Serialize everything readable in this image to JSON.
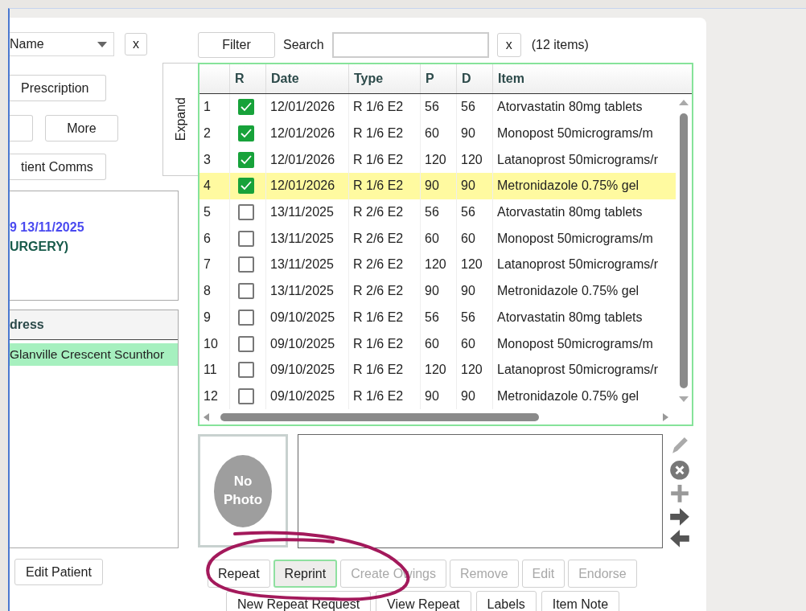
{
  "left_panel": {
    "sort_dropdown": {
      "value": "Name"
    },
    "clear_button": "x",
    "buttons": [
      {
        "kind": "wide",
        "label": "Prescription"
      },
      {
        "kind": "stub"
      },
      {
        "kind": "normal",
        "label": "More"
      },
      {
        "kind": "wide",
        "label": "tient Comms"
      }
    ],
    "info": [
      {
        "kind": "date",
        "text": "9 13/11/2025"
      },
      {
        "kind": "practice",
        "text": "URGERY)"
      }
    ],
    "address_table": {
      "column": "dress",
      "rows": [
        {
          "text": "Glanville Crescent Scunthor",
          "selected": true
        }
      ]
    },
    "edit_button": {
      "label": "Edit Patient"
    }
  },
  "expand_tab": {
    "label": "Expand"
  },
  "toolbar": {
    "filter_button": {
      "label": "Filter"
    },
    "search_label": "Search",
    "clear_button": "x",
    "count": "(12 items)"
  },
  "table": {
    "columns": [
      "R",
      "Date",
      "Type",
      "P",
      "D",
      "Item"
    ],
    "rows": [
      {
        "num": "1",
        "checked": true,
        "date": "12/01/2026",
        "type": "R 1/6 E2",
        "p": "56",
        "d": "56",
        "item": "Atorvastatin 80mg tablets",
        "selected": false
      },
      {
        "num": "2",
        "checked": true,
        "date": "12/01/2026",
        "type": "R 1/6 E2",
        "p": "60",
        "d": "90",
        "item": "Monopost 50micrograms/m",
        "selected": false
      },
      {
        "num": "3",
        "checked": true,
        "date": "12/01/2026",
        "type": "R 1/6 E2",
        "p": "120",
        "d": "120",
        "item": "Latanoprost 50micrograms/r",
        "selected": false
      },
      {
        "num": "4",
        "checked": true,
        "date": "12/01/2026",
        "type": "R 1/6 E2",
        "p": "90",
        "d": "90",
        "item": "Metronidazole 0.75% gel",
        "selected": true
      },
      {
        "num": "5",
        "checked": false,
        "date": "13/11/2025",
        "type": "R 2/6 E2",
        "p": "56",
        "d": "56",
        "item": "Atorvastatin 80mg tablets",
        "selected": false
      },
      {
        "num": "6",
        "checked": false,
        "date": "13/11/2025",
        "type": "R 2/6 E2",
        "p": "60",
        "d": "60",
        "item": "Monopost 50micrograms/m",
        "selected": false
      },
      {
        "num": "7",
        "checked": false,
        "date": "13/11/2025",
        "type": "R 2/6 E2",
        "p": "120",
        "d": "120",
        "item": "Latanoprost 50micrograms/r",
        "selected": false
      },
      {
        "num": "8",
        "checked": false,
        "date": "13/11/2025",
        "type": "R 2/6 E2",
        "p": "90",
        "d": "90",
        "item": "Metronidazole 0.75% gel",
        "selected": false
      },
      {
        "num": "9",
        "checked": false,
        "date": "09/10/2025",
        "type": "R 1/6 E2",
        "p": "56",
        "d": "56",
        "item": "Atorvastatin 80mg tablets",
        "selected": false
      },
      {
        "num": "10",
        "checked": false,
        "date": "09/10/2025",
        "type": "R 1/6 E2",
        "p": "60",
        "d": "60",
        "item": "Monopost 50micrograms/m",
        "selected": false
      },
      {
        "num": "11",
        "checked": false,
        "date": "09/10/2025",
        "type": "R 1/6 E2",
        "p": "120",
        "d": "120",
        "item": "Latanoprost 50micrograms/r",
        "selected": false
      },
      {
        "num": "12",
        "checked": false,
        "date": "09/10/2025",
        "type": "R 1/6 E2",
        "p": "90",
        "d": "90",
        "item": "Metronidazole 0.75% gel",
        "selected": false
      }
    ]
  },
  "photo": {
    "text": "No Photo"
  },
  "side_tools": [
    {
      "kind": "pencil"
    },
    {
      "kind": "remove"
    },
    {
      "kind": "add"
    },
    {
      "kind": "right"
    },
    {
      "kind": "left"
    }
  ],
  "action_buttons": [
    {
      "label": "Repeat",
      "disabled": false,
      "selected": false
    },
    {
      "label": "Reprint",
      "disabled": false,
      "selected": true
    },
    {
      "label": "Create Owings",
      "disabled": true,
      "selected": false
    },
    {
      "label": "Remove",
      "disabled": true,
      "selected": false
    },
    {
      "label": "Edit",
      "disabled": true,
      "selected": false
    },
    {
      "label": "Endorse",
      "disabled": true,
      "selected": false
    }
  ],
  "secondary_buttons": [
    {
      "label": "New Repeat Request"
    },
    {
      "label": "View Repeat"
    },
    {
      "label": "Labels"
    },
    {
      "label": "Item Note"
    }
  ],
  "annotation": {
    "kind": "ellipse",
    "color": "#a3195b"
  }
}
